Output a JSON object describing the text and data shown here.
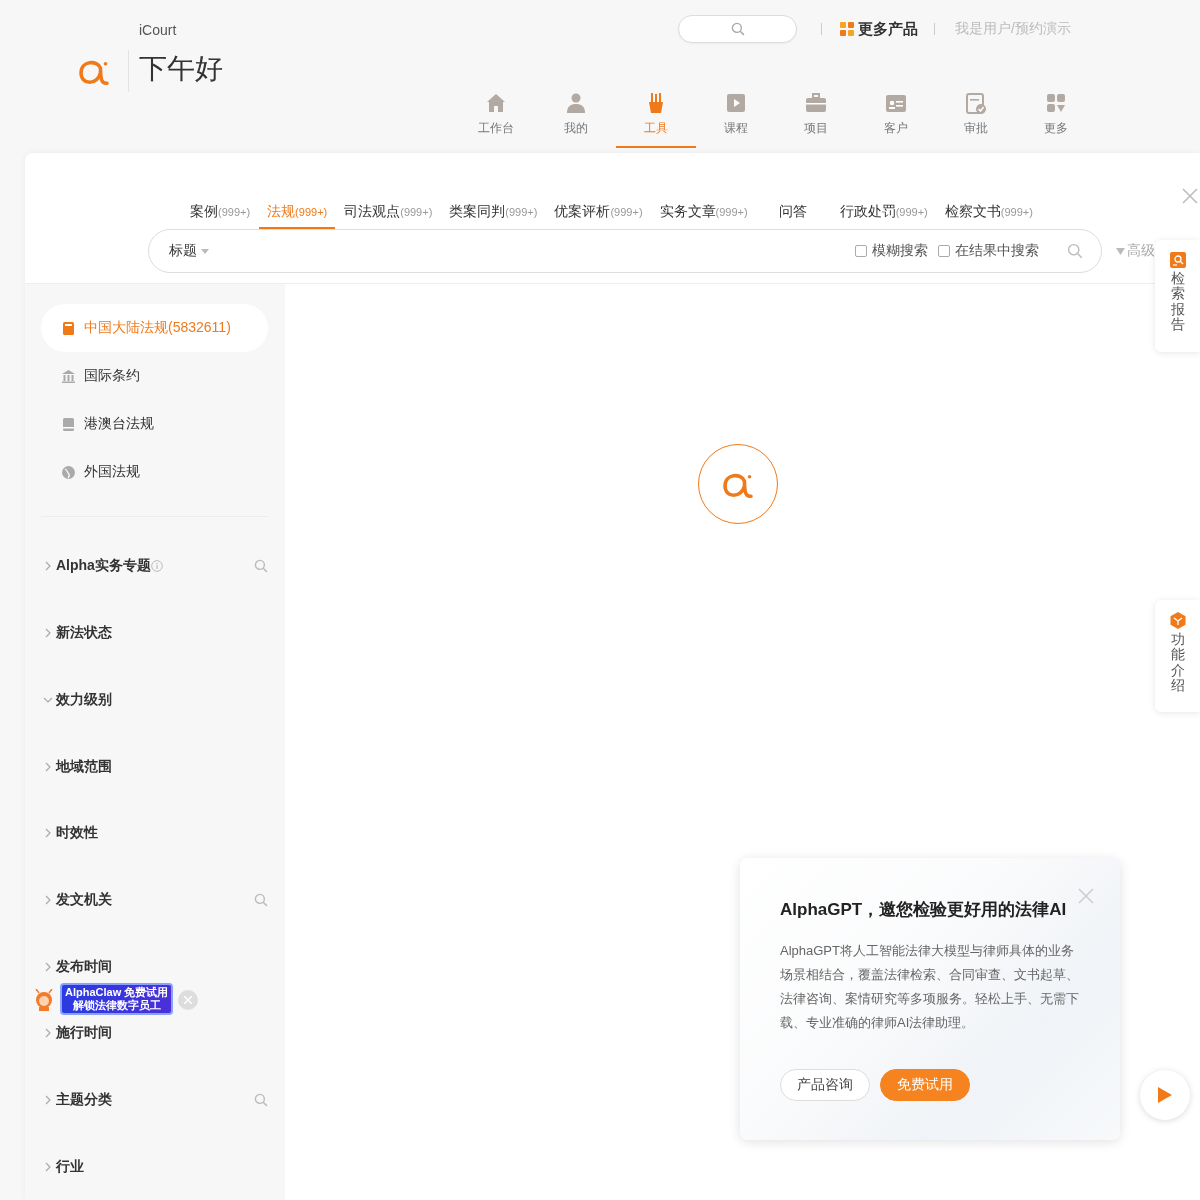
{
  "header": {
    "brand": "iCourt",
    "greeting": "下午好",
    "more_products": "更多产品",
    "user_link": "我是用户/预约演示"
  },
  "nav": [
    {
      "label": "工作台",
      "selected": false
    },
    {
      "label": "我的",
      "selected": false
    },
    {
      "label": "工具",
      "selected": true
    },
    {
      "label": "课程",
      "selected": false
    },
    {
      "label": "项目",
      "selected": false
    },
    {
      "label": "客户",
      "selected": false
    },
    {
      "label": "审批",
      "selected": false
    },
    {
      "label": "更多",
      "selected": false
    }
  ],
  "search_tabs": [
    {
      "label": "案例",
      "count": "(999+)",
      "selected": false
    },
    {
      "label": "法规",
      "count": "(999+)",
      "selected": true
    },
    {
      "label": "司法观点",
      "count": "(999+)",
      "selected": false
    },
    {
      "label": "类案同判",
      "count": "(999+)",
      "selected": false
    },
    {
      "label": "优案评析",
      "count": "(999+)",
      "selected": false
    },
    {
      "label": "实务文章",
      "count": "(999+)",
      "selected": false
    },
    {
      "label": "问答",
      "selected": false
    },
    {
      "label": "行政处罚",
      "count": "(999+)",
      "selected": false
    },
    {
      "label": "检察文书",
      "count": "(999+)",
      "selected": false
    }
  ],
  "search": {
    "scope": "标题",
    "options": [
      {
        "label": "模糊搜索",
        "checked": false
      },
      {
        "label": "在结果中搜索",
        "checked": false
      }
    ],
    "advanced": "高级"
  },
  "sources": [
    {
      "label": "中国大陆法规(5832611)",
      "selected": true
    },
    {
      "label": "国际条约",
      "selected": false
    },
    {
      "label": "港澳台法规",
      "selected": false
    },
    {
      "label": "外国法规",
      "selected": false
    }
  ],
  "filters": [
    {
      "label": "Alpha实务专题",
      "info": true,
      "searchable": true,
      "expanded": false
    },
    {
      "label": "新法状态",
      "info": false,
      "searchable": false,
      "expanded": false
    },
    {
      "label": "效力级别",
      "info": false,
      "searchable": false,
      "expanded": true
    },
    {
      "label": "地域范围",
      "info": false,
      "searchable": false,
      "expanded": false
    },
    {
      "label": "时效性",
      "info": false,
      "searchable": false,
      "expanded": false
    },
    {
      "label": "发文机关",
      "info": false,
      "searchable": true,
      "expanded": false
    },
    {
      "label": "发布时间",
      "info": false,
      "searchable": false,
      "expanded": false
    },
    {
      "label": "施行时间",
      "info": false,
      "searchable": false,
      "expanded": false
    },
    {
      "label": "主题分类",
      "info": false,
      "searchable": true,
      "expanded": false
    },
    {
      "label": "行业",
      "info": false,
      "searchable": false,
      "expanded": false
    }
  ],
  "sticker": {
    "lines": [
      "AlphaClaw 免费试用",
      "解锁法律数字员工"
    ]
  },
  "promo": {
    "title": "AlphaGPT，邀您检验更好用的法律AI",
    "body": "AlphaGPT将人工智能法律大模型与律师具体的业务场景相结合，覆盖法律检索、合同审查、文书起草、法律咨询、案情研究等多项服务。轻松上手、无需下载、专业准确的律师AI法律助理。",
    "buttons": [
      {
        "label": "产品咨询",
        "kind": "secondary"
      },
      {
        "label": "免费试用",
        "kind": "primary"
      }
    ]
  },
  "side_tabs": [
    {
      "label": "检索报告"
    },
    {
      "label": "功能介绍"
    }
  ]
}
